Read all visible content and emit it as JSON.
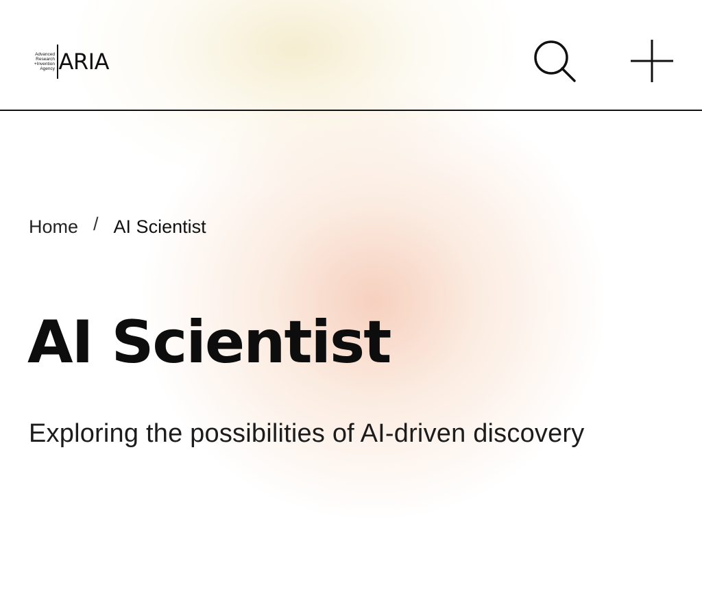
{
  "header": {
    "logo": {
      "agency_line1": "Advanced",
      "agency_line2": "Research",
      "agency_line3": "+Invention",
      "agency_line4": "Agency",
      "wordmark": "ARIA"
    },
    "search_icon": "search-icon",
    "menu_icon": "plus-icon"
  },
  "breadcrumb": {
    "home": "Home",
    "separator": "/",
    "current": "AI Scientist"
  },
  "page": {
    "title": "AI Scientist",
    "subtitle": "Exploring the possibilities of AI-driven discovery"
  },
  "colors": {
    "text": "#111111",
    "background": "#ffffff",
    "glow_warm": "#f5c8b4",
    "glow_yellow": "#f4eac8"
  }
}
